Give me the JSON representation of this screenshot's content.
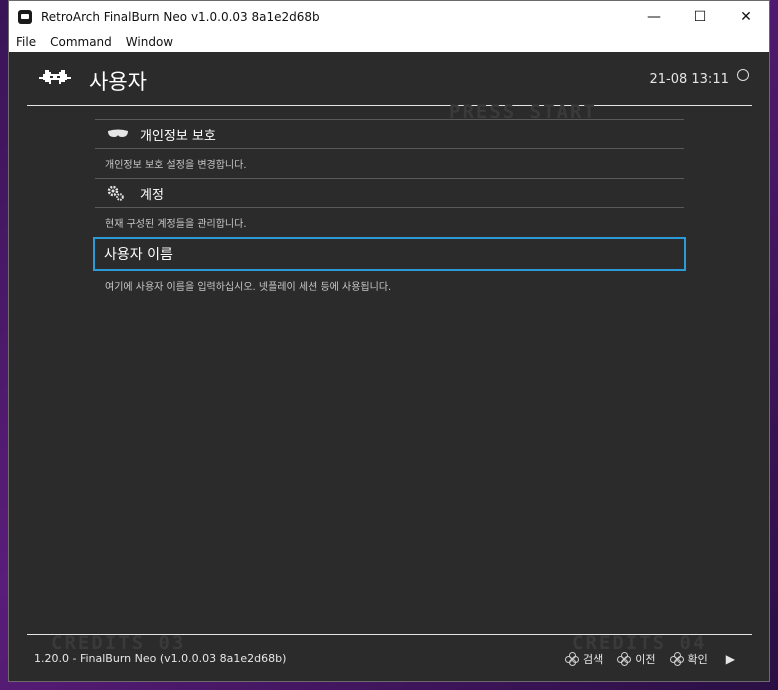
{
  "window": {
    "title": "RetroArch FinalBurn Neo v1.0.0.03  8a1e2d68b",
    "controls": {
      "minimize": "—",
      "maximize": "☐",
      "close": "✕"
    }
  },
  "menubar": [
    "File",
    "Command",
    "Window"
  ],
  "header": {
    "icon": "retroarch-invader-icon",
    "title": "사용자",
    "clock": "21-08 13:11"
  },
  "watermarks": {
    "press_start": "PRESS START",
    "credits_left": "CREDITS 03",
    "credits_right": "CREDITS 04"
  },
  "entries": [
    {
      "icon": "mask-icon",
      "label": "개인정보 보호",
      "description": "개인정보 보호 설정을 변경합니다."
    },
    {
      "icon": "gears-icon",
      "label": "계정",
      "description": "현재 구성된 계정들을 관리합니다."
    },
    {
      "icon": "",
      "label": "사용자 이름",
      "description": "여기에 사용자 이름을 입력하십시오. 넷플레이 세션 등에 사용됩니다.",
      "selected": true
    }
  ],
  "footer": {
    "version": "1.20.0 - FinalBurn Neo (v1.0.0.03 8a1e2d68b)",
    "actions": [
      {
        "icon": "gamepad-icon",
        "label": "검색"
      },
      {
        "icon": "gamepad-icon",
        "label": "이전"
      },
      {
        "icon": "gamepad-icon",
        "label": "확인"
      }
    ],
    "play_icon": "▶"
  },
  "colors": {
    "background": "#2b2b2b",
    "selection_border": "#2a9ad8",
    "text": "#e6e6e6"
  }
}
